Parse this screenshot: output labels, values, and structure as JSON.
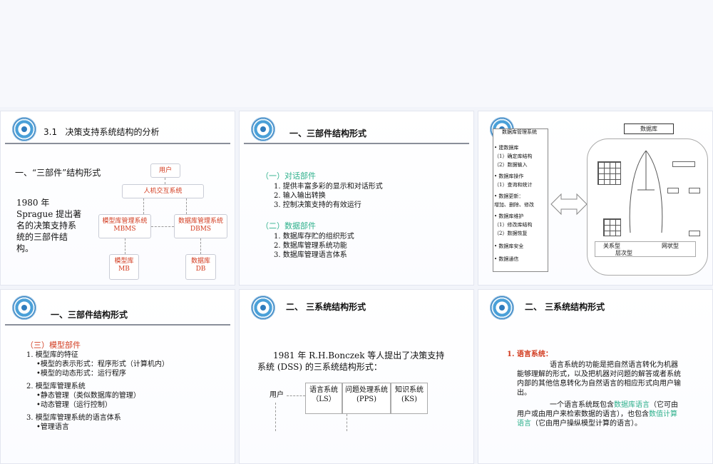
{
  "slides": [
    {
      "title_num": "3.1",
      "title": "决策支持系统结构的分析",
      "heading": "一、“三部件”结构形式",
      "body_lines": [
        "1980 年",
        "Sprague 提出著",
        "名的决策支持系",
        "统的三部件结",
        "构。"
      ],
      "diagram": {
        "user": "用户",
        "hci": "人机交互系统",
        "mbms": [
          "模型库管理系统",
          "MBMS"
        ],
        "dbms": [
          "数据库管理系统",
          "DBMS"
        ],
        "mb": [
          "模型库",
          "MB"
        ],
        "db": [
          "数据库",
          "DB"
        ]
      }
    },
    {
      "title": "一、三部件结构形式",
      "sec1": "（一）对话部件",
      "sec1_items": [
        "1.  提供丰富多彩的显示和对话形式",
        "2.  输入输出转换",
        "3.  控制决策支持的有效运行"
      ],
      "sec2": "（二）数据部件",
      "sec2_items": [
        "1.  数据库存贮的组织形式",
        "2.  数据库管理系统功能",
        "3.  数据库管理语言体系"
      ]
    },
    {
      "left_title": "数据库管理系统",
      "items": [
        "•  建数据库",
        "（1）确定库结构",
        "（2）数据输入",
        "•  数据库操作",
        "（1）查询和统计",
        "•  数据更新：",
        "增加、删除、修改",
        "•  数据库维护",
        "（1）修改库结构",
        "（2）数据恢复",
        "•  数据库安全",
        "•  数据通信"
      ],
      "db_box": "数据库",
      "relational": "关系型",
      "hierarchical": "层次型",
      "network": "网状型"
    },
    {
      "title": "一、三部件结构形式",
      "sec": "（三）模型部件",
      "lines": [
        "1.  模型库的特征",
        "•模型的表示形式：程序形式（计算机内）",
        "•模型的动态形式：运行程序",
        "2.  模型库管理系统",
        "•静态管理（类似数据库的管理）",
        "•动态管理（运行控制）",
        "3.  模型库管理系统的语言体系",
        "•管理语言"
      ]
    },
    {
      "title": "二、 三系统结构形式",
      "line1": "1981 年 R.H.Bonczek 等人提出了决策支持",
      "line2": "系统 (DSS) 的三系统结构形式：",
      "user": "用户",
      "ls": [
        "语言系统",
        "（LS）"
      ],
      "pps": [
        "问题处理系统",
        "(PPS)"
      ],
      "ks": [
        "知识系统",
        "(KS)"
      ]
    },
    {
      "title": "二、 三系统结构形式",
      "item_label": "1.  语言系统：",
      "p1": [
        "语言系统的功能是把自然语言转化为机器",
        "能够理解的形式，以及把机器对问题的解答或者系统",
        "内部的其他信息转化为自然语言的相应形式向用户输",
        "出。"
      ],
      "p2_a": "一个语言系统既包含",
      "p2_b": "数据库语言",
      "p2_c": "（它可由",
      "p3": "用户或由用户来检索数据的语言），也包含",
      "p3_b": "数值计算",
      "p4_a": "语言",
      "p4_b": "（它由用户操纵模型计算的语言）。"
    }
  ]
}
